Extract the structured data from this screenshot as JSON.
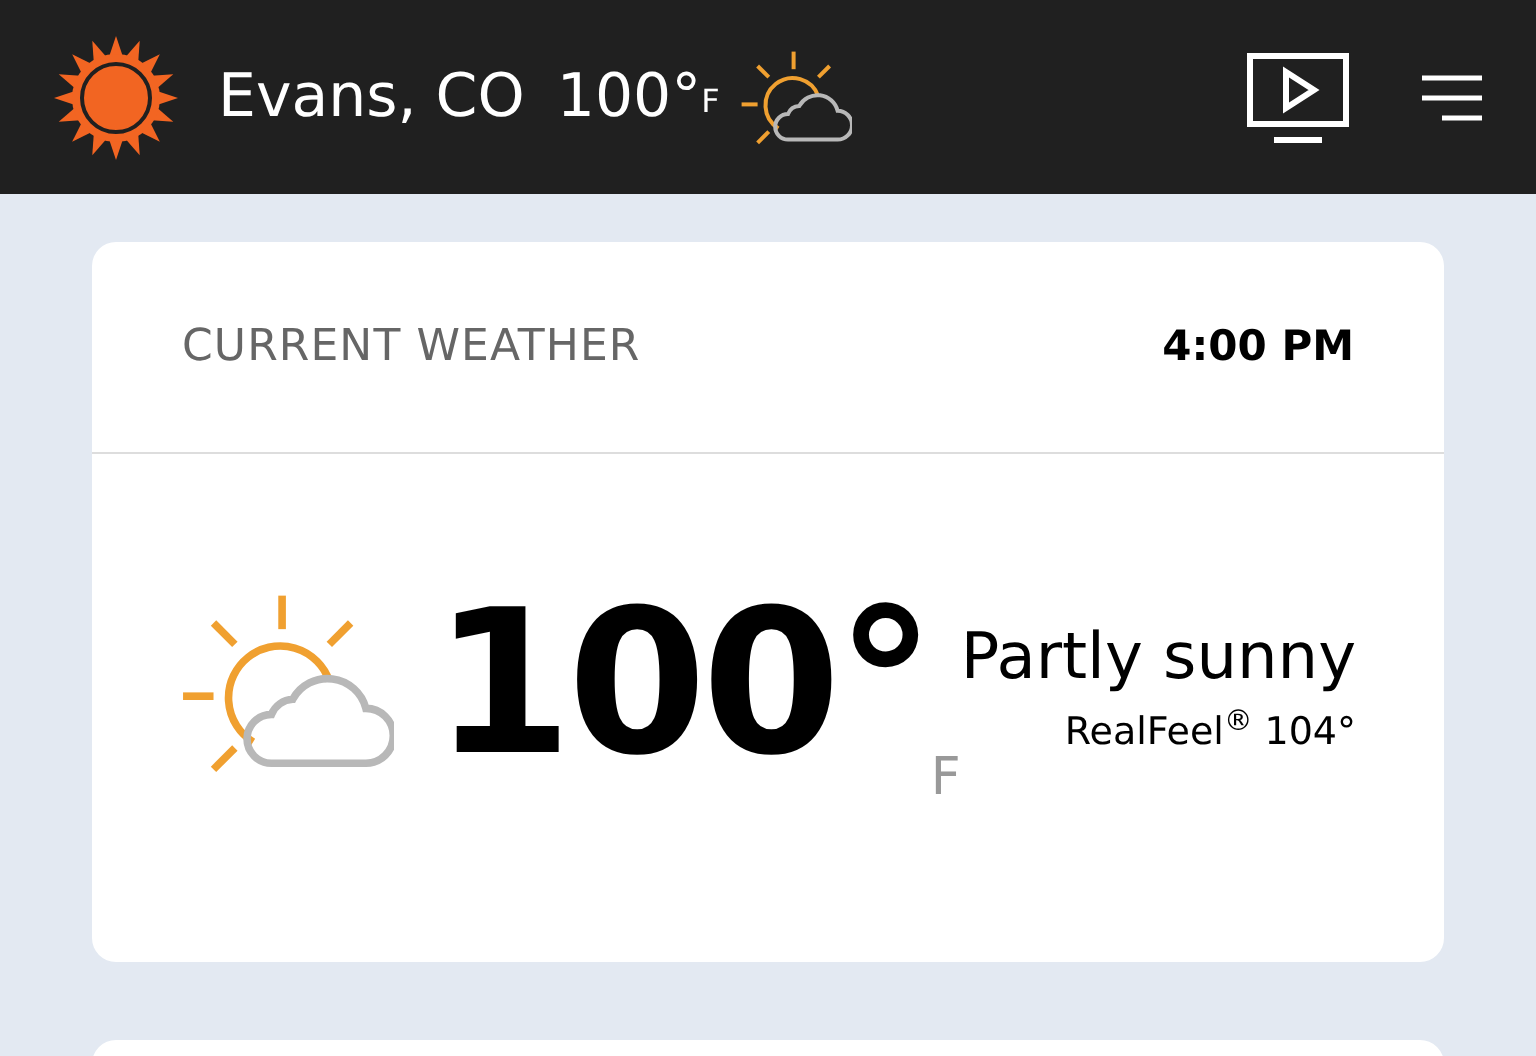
{
  "header": {
    "location": "Evans, CO",
    "temperature": "100°",
    "unit": "F"
  },
  "card": {
    "title": "CURRENT WEATHER",
    "time": "4:00 PM",
    "temperature": "100°",
    "unit": "F",
    "condition": "Partly sunny",
    "realfeel": "RealFeel$^{®}$ 104°"
  }
}
